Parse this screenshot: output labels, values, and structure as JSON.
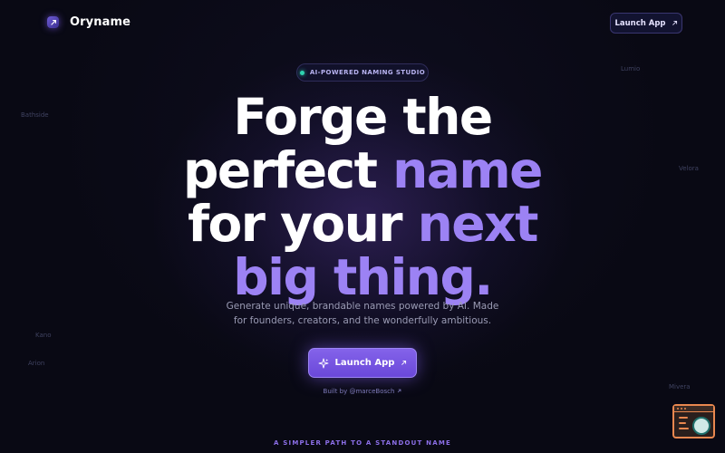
{
  "brand": {
    "name": "Oryname"
  },
  "header": {
    "launch_label": "Launch App"
  },
  "floating_names": [
    "Lumio",
    "Bathside",
    "Velora",
    "Kano",
    "Arion",
    "Mivera"
  ],
  "badge": {
    "text": "AI-POWERED NAMING STUDIO"
  },
  "headline": {
    "line1": "Forge the",
    "line2_white": "perfect ",
    "line2_accent": "name",
    "line3_white": "for your ",
    "line3_accent": "next",
    "line4_accent": "big thing."
  },
  "subtitle": {
    "line1": "Generate unique, brandable names powered by AI. Made",
    "line2": "for founders, creators, and the wonderfully ambitious."
  },
  "cta": {
    "label": "Launch App"
  },
  "built_by": {
    "text": "Built by @marceBosch"
  },
  "section_label": "A SIMPLER PATH TO A STANDOUT NAME",
  "colors": {
    "background": "#090914",
    "accent": "#9c82f4",
    "badge_dot": "#2fd3b0",
    "widget": "#e8874f"
  }
}
